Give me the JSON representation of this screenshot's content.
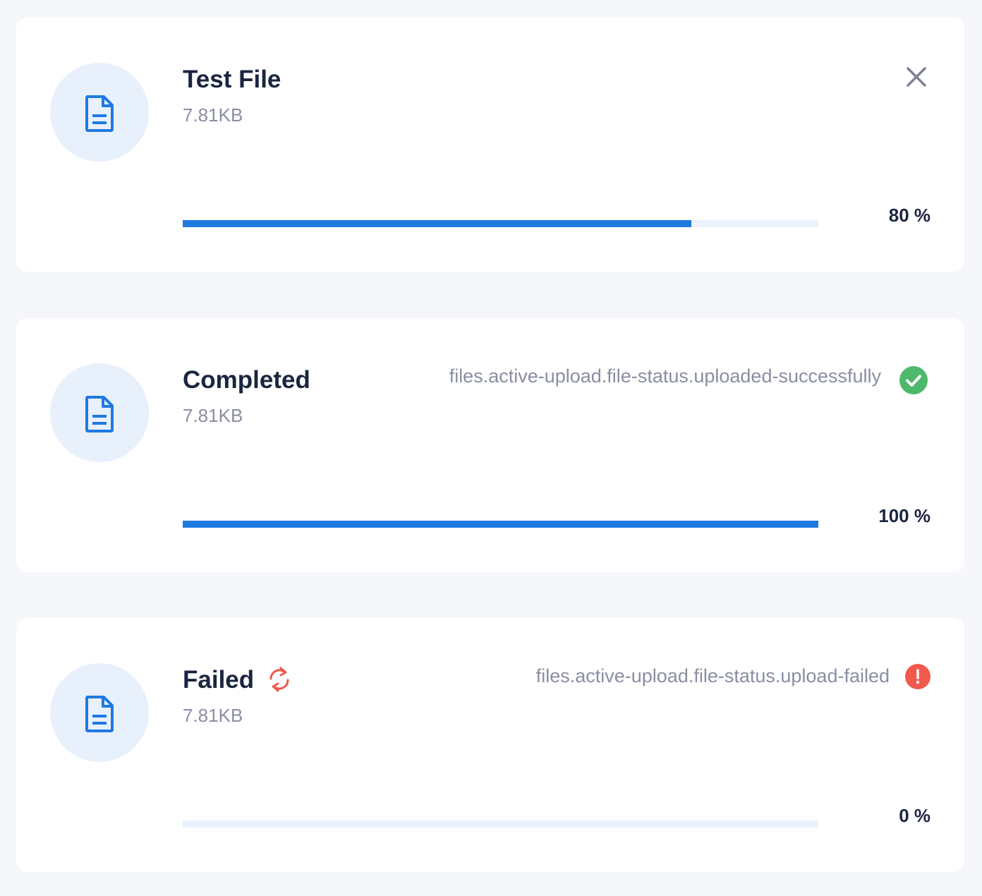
{
  "uploads": [
    {
      "name": "Test File",
      "size": "7.81KB",
      "progress": 80,
      "progress_label": "80 %",
      "state": "uploading",
      "icon": "file-document-icon",
      "action_icon": "close-icon"
    },
    {
      "name": "Completed",
      "size": "7.81KB",
      "progress": 100,
      "progress_label": "100 %",
      "state": "completed",
      "status_text": "files.active-upload.file-status.uploaded-successfully",
      "icon": "file-document-icon",
      "status_icon": "check-circle-icon"
    },
    {
      "name": "Failed",
      "size": "7.81KB",
      "progress": 0,
      "progress_label": "0 %",
      "state": "failed",
      "status_text": "files.active-upload.file-status.upload-failed",
      "icon": "file-document-icon",
      "status_icon": "error-circle-icon",
      "action_icon": "retry-icon"
    }
  ],
  "colors": {
    "accent": "#1f7ae0",
    "success": "#4cb96b",
    "error": "#f0594c",
    "title": "#1b2540",
    "muted": "#8a8ea3",
    "track": "#e8f1fc",
    "icon_bg": "#e8f0fc",
    "page_bg": "#f5f7fb"
  }
}
